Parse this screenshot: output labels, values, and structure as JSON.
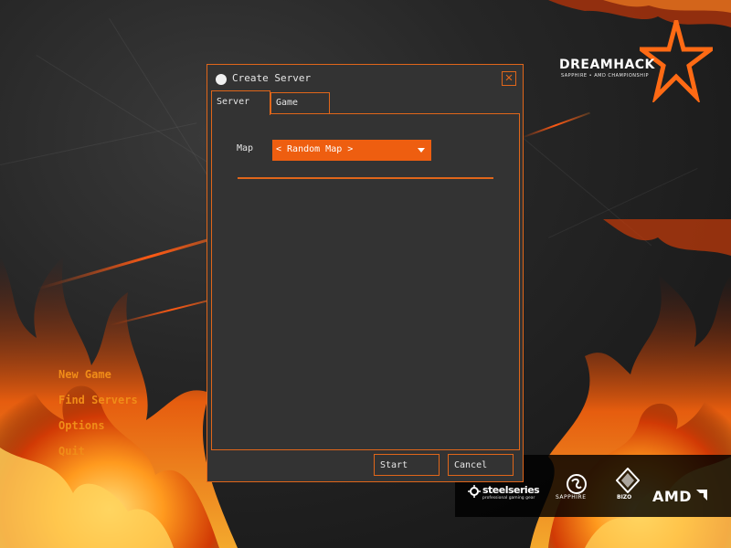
{
  "window": {
    "title": "Create Server",
    "close_icon": "close-icon"
  },
  "tabs": [
    {
      "label": "Server",
      "active": true
    },
    {
      "label": "Game",
      "active": false
    }
  ],
  "server_tab": {
    "map_label": "Map",
    "map_value": "< Random Map >"
  },
  "buttons": {
    "start": "Start",
    "cancel": "Cancel"
  },
  "main_menu": {
    "items": [
      "New Game",
      "Find Servers",
      "Options",
      "Quit"
    ]
  },
  "branding": {
    "logo_title": "DREAMHACK",
    "logo_subtitle": "SAPPHIRE • AMD CHAMPIONSHIP"
  },
  "sponsors": {
    "steelseries": "steelseries",
    "steelseries_tagline": "professional gaming gear",
    "sapphire": "SAPPHIRE",
    "bizo": "BIZO",
    "amd": "AMD"
  },
  "colors": {
    "accent": "#e0661a",
    "select_bg": "#ee5e10",
    "dialog_bg": "#333333",
    "menu_text": "#f08c18"
  }
}
